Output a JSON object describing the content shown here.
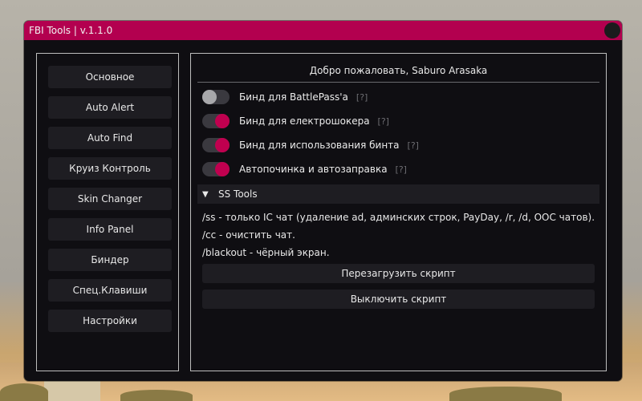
{
  "window": {
    "title": "FBI Tools | v.1.1.0"
  },
  "sidebar": {
    "items": [
      {
        "label": "Основное"
      },
      {
        "label": "Auto Alert"
      },
      {
        "label": "Auto Find"
      },
      {
        "label": "Круиз Контроль"
      },
      {
        "label": "Skin Changer"
      },
      {
        "label": "Info Panel"
      },
      {
        "label": "Биндер"
      },
      {
        "label": "Спец.Клавиши"
      },
      {
        "label": "Настройки"
      }
    ]
  },
  "main": {
    "welcome": "Добро пожаловать, Saburo Arasaka",
    "toggles": [
      {
        "label": "Бинд для BattlePass'a",
        "help": "[?]",
        "state": "off"
      },
      {
        "label": "Бинд для електрошокера",
        "help": "[?]",
        "state": "on"
      },
      {
        "label": "Бинд для использования бинта",
        "help": "[?]",
        "state": "on"
      },
      {
        "label": "Автопочинка и автозаправка",
        "help": "[?]",
        "state": "on"
      }
    ],
    "section": {
      "arrow": "▼",
      "title": "SS Tools"
    },
    "commands": [
      "/ss - только IC чат (удаление ad, админских строк, PayDay, /r, /d, OOC чатов).",
      "/cc - очистить чат.",
      "/blackout - чёрный экран."
    ],
    "buttons": {
      "reload": "Перезагрузить скрипт",
      "disable": "Выключить скрипт"
    }
  },
  "colors": {
    "accent": "#b3004f",
    "toggle_on": "#c0004f",
    "toggle_off": "#a8a8ab",
    "panel": "#0f0e12",
    "item_bg": "#1e1d22"
  }
}
